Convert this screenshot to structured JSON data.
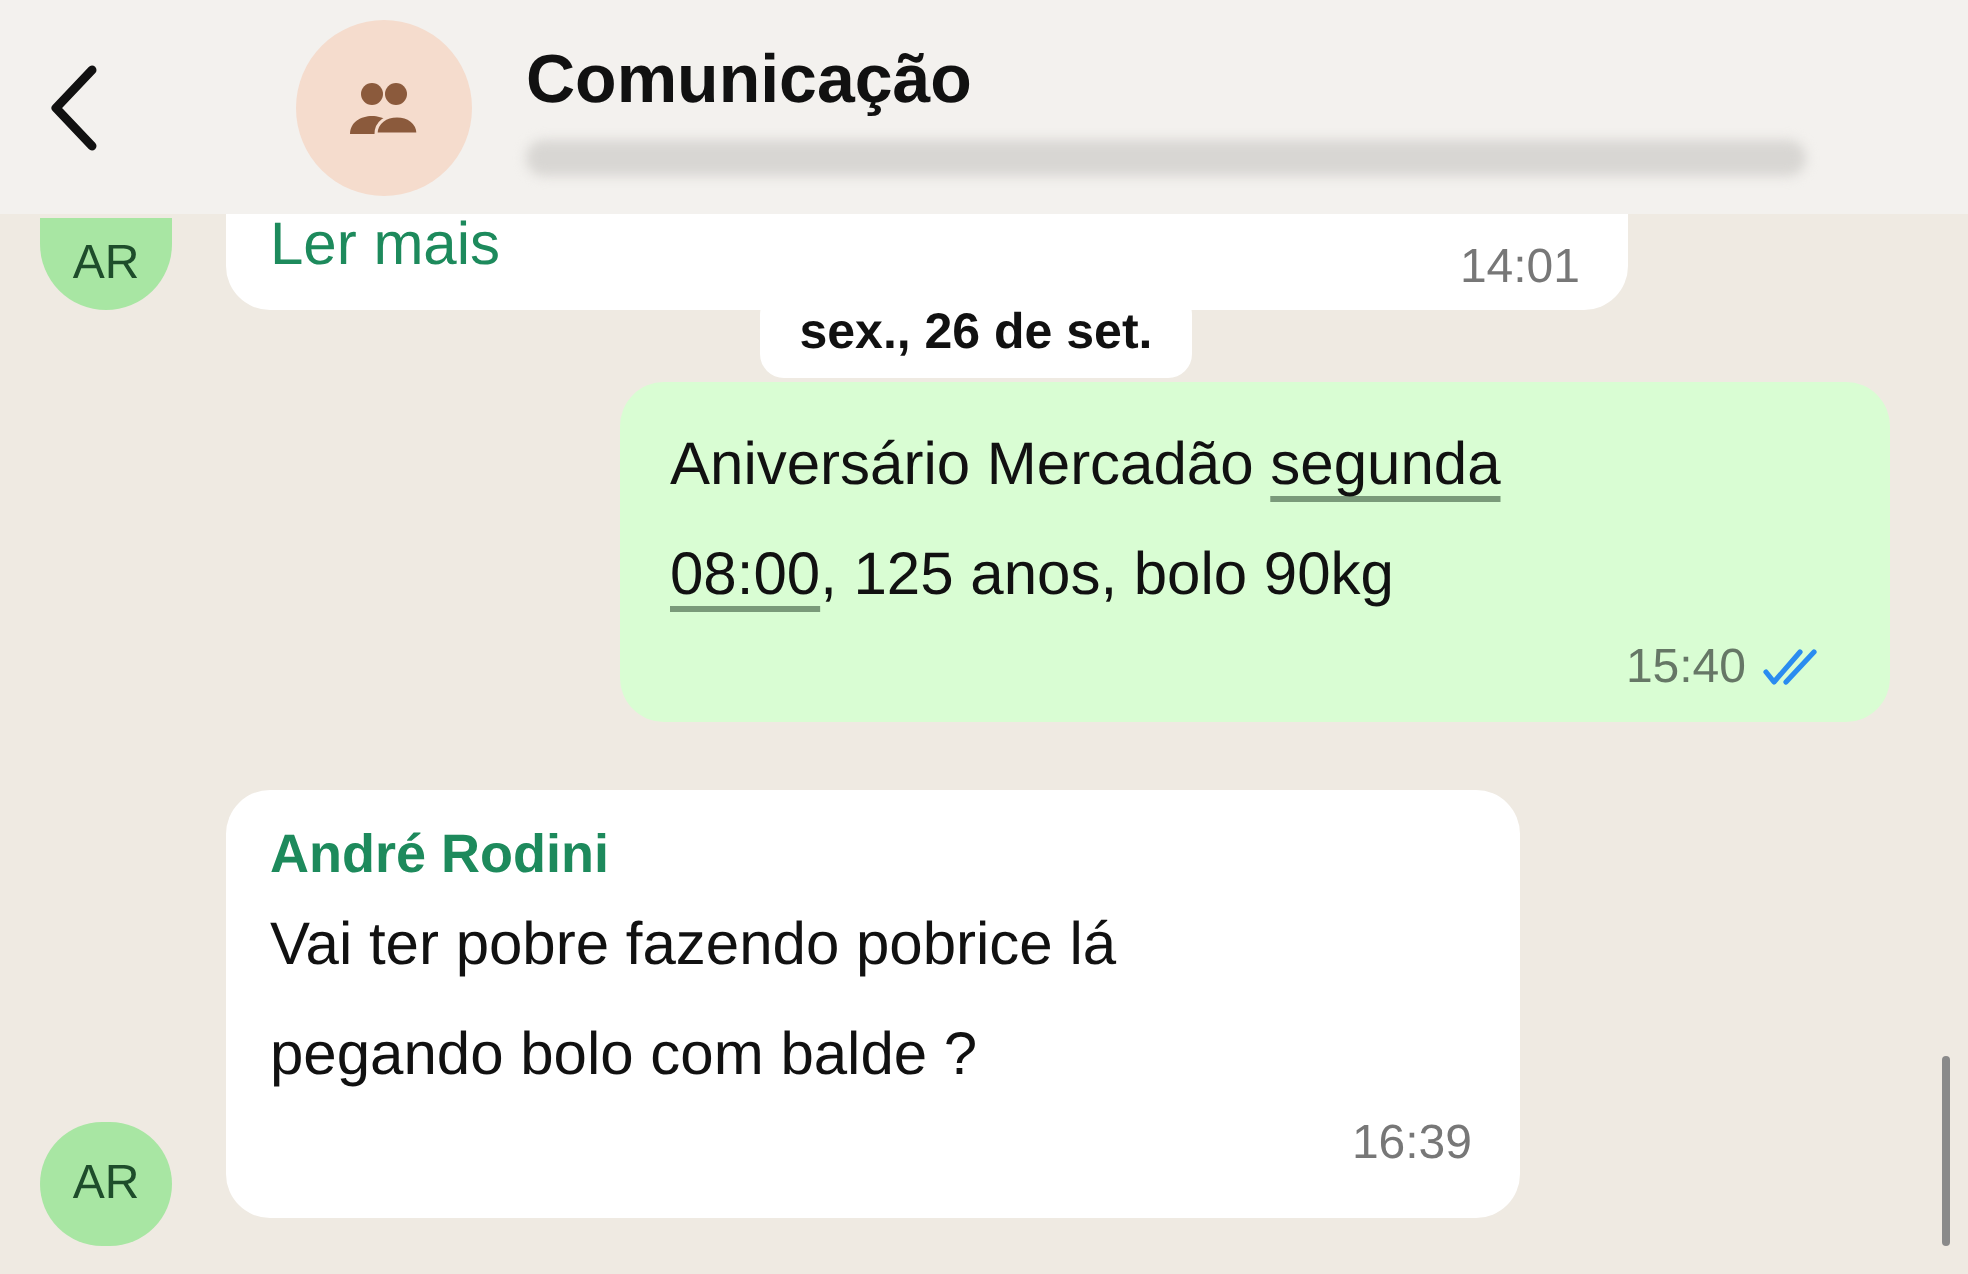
{
  "header": {
    "title": "Comunicação"
  },
  "messages": [
    {
      "kind": "incoming",
      "avatar": "AR",
      "text": [
        {
          "kind": "read_more",
          "text": "Ler mais"
        }
      ],
      "time": "14:01"
    },
    {
      "kind": "date",
      "text": "sex., 26 de set."
    },
    {
      "kind": "outgoing",
      "text": [
        {
          "kind": "plain",
          "text": "Aniversário Mercadão "
        },
        {
          "kind": "link",
          "text": "segunda "
        },
        {
          "kind": "link",
          "text": "08:00"
        },
        {
          "kind": "plain",
          "text": ", 125 anos, bolo 90kg"
        }
      ],
      "time": "15:40",
      "read": true
    },
    {
      "kind": "incoming",
      "avatar": "AR",
      "sender": "André Rodini",
      "text": [
        {
          "kind": "plain",
          "text": "Vai ter pobre fazendo pobrice lá pegando bolo com balde  ?"
        }
      ],
      "time": "16:39"
    }
  ]
}
